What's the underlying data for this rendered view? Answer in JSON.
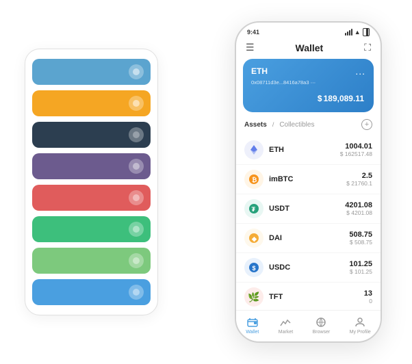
{
  "scene": {
    "bg_panel": {
      "cards": [
        {
          "color": "card-blue",
          "icon": "🔵"
        },
        {
          "color": "card-orange",
          "icon": "🟡"
        },
        {
          "color": "card-dark",
          "icon": "⚙️"
        },
        {
          "color": "card-purple",
          "icon": "M"
        },
        {
          "color": "card-red",
          "icon": "❤"
        },
        {
          "color": "card-green",
          "icon": "💚"
        },
        {
          "color": "card-lightgreen",
          "icon": "🟢"
        },
        {
          "color": "card-lightblue",
          "icon": "🔷"
        }
      ]
    },
    "phone": {
      "status_bar": {
        "time": "9:41",
        "signal": "●●●●",
        "wifi": "▲",
        "battery": "▐"
      },
      "header": {
        "menu_icon": "☰",
        "title": "Wallet",
        "expand_icon": "⛶"
      },
      "eth_card": {
        "label": "ETH",
        "address": "0x08711d3e...8416a78a3  ⋯",
        "dots": "...",
        "balance_symbol": "$",
        "balance": "189,089.11"
      },
      "assets_section": {
        "tab_active": "Assets",
        "separator": "/",
        "tab_inactive": "Collectibles",
        "add_label": "+"
      },
      "assets": [
        {
          "name": "ETH",
          "icon_color": "#627eea",
          "icon_char": "♦",
          "amount": "1004.01",
          "usd": "$ 162517.48"
        },
        {
          "name": "imBTC",
          "icon_color": "#f7931a",
          "icon_char": "₿",
          "amount": "2.5",
          "usd": "$ 21760.1"
        },
        {
          "name": "USDT",
          "icon_color": "#26a17b",
          "icon_char": "₮",
          "amount": "4201.08",
          "usd": "$ 4201.08"
        },
        {
          "name": "DAI",
          "icon_color": "#f5ac37",
          "icon_char": "◆",
          "amount": "508.75",
          "usd": "$ 508.75"
        },
        {
          "name": "USDC",
          "icon_color": "#2775ca",
          "icon_char": "$",
          "amount": "101.25",
          "usd": "$ 101.25"
        },
        {
          "name": "TFT",
          "icon_color": "#e05c5c",
          "icon_char": "🌿",
          "amount": "13",
          "usd": "0"
        }
      ],
      "bottom_nav": [
        {
          "label": "Wallet",
          "active": true,
          "icon": "wallet"
        },
        {
          "label": "Market",
          "active": false,
          "icon": "market"
        },
        {
          "label": "Browser",
          "active": false,
          "icon": "browser"
        },
        {
          "label": "My Profile",
          "active": false,
          "icon": "profile"
        }
      ]
    }
  }
}
